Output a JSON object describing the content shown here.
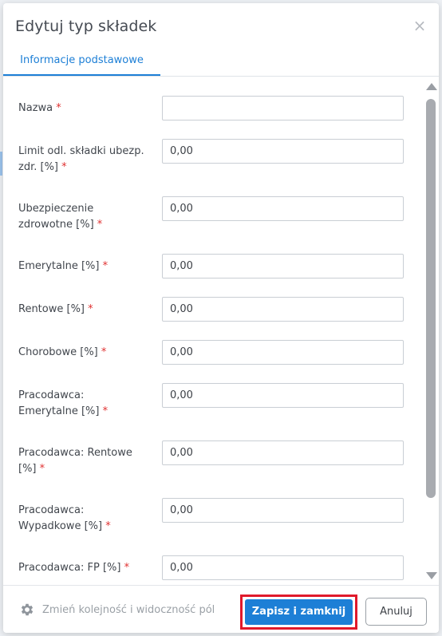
{
  "dialog": {
    "title": "Edytuj typ składek",
    "close_symbol": "×"
  },
  "tabs": [
    {
      "label": "Informacje podstawowe",
      "active": true
    }
  ],
  "fields": [
    {
      "label": "Nazwa",
      "required": "*",
      "value": ""
    },
    {
      "label": "Limit odl. składki ubezp. zdr. [%]",
      "required": "*",
      "value": "0,00"
    },
    {
      "label": "Ubezpieczenie zdrowotne [%]",
      "required": "*",
      "value": "0,00"
    },
    {
      "label": "Emerytalne [%]",
      "required": "*",
      "value": "0,00"
    },
    {
      "label": "Rentowe [%]",
      "required": "*",
      "value": "0,00"
    },
    {
      "label": "Chorobowe [%]",
      "required": "*",
      "value": "0,00"
    },
    {
      "label": "Pracodawca: Emerytalne [%]",
      "required": "*",
      "value": "0,00"
    },
    {
      "label": "Pracodawca: Rentowe [%]",
      "required": "*",
      "value": "0,00"
    },
    {
      "label": "Pracodawca: Wypadkowe [%]",
      "required": "*",
      "value": "0,00"
    },
    {
      "label": "Pracodawca: FP [%]",
      "required": "*",
      "value": "0,00"
    }
  ],
  "footer": {
    "settings_label": "Zmień kolejność i widoczność pól",
    "settings_icon": "gear-icon",
    "save_label": "Zapisz i zamknij",
    "cancel_label": "Anuluj"
  },
  "colors": {
    "accent": "#1d7fd6",
    "required": "#e03131",
    "highlight": "#e0192b"
  }
}
